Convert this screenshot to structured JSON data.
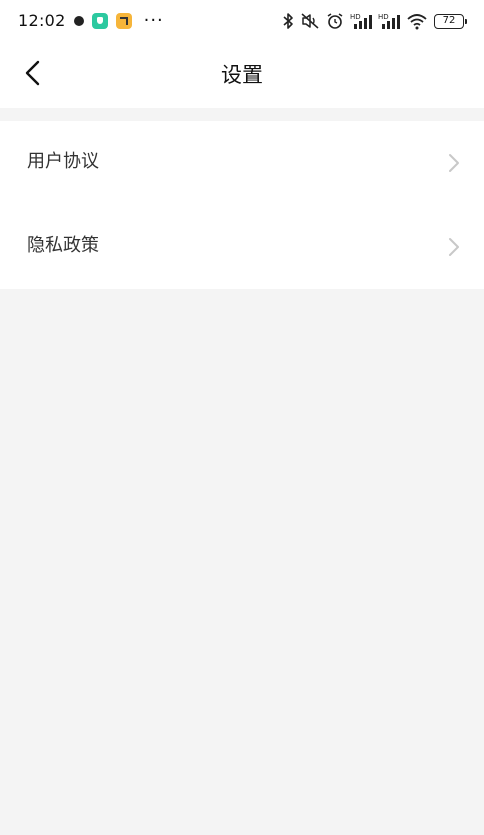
{
  "status_bar": {
    "time": "12:02",
    "more": "···",
    "battery_level": "72",
    "icons": [
      "dot-icon",
      "app-shield-icon",
      "app-mail-icon",
      "bluetooth-icon",
      "mute-icon",
      "alarm-icon",
      "signal-hd-icon",
      "signal-hd-icon",
      "wifi-icon",
      "battery-icon"
    ]
  },
  "header": {
    "title": "设置",
    "back_icon": "chevron-left-icon"
  },
  "settings": {
    "items": [
      {
        "label": "用户协议",
        "icon": "chevron-right-icon"
      },
      {
        "label": "隐私政策",
        "icon": "chevron-right-icon"
      }
    ]
  },
  "colors": {
    "background": "#f4f4f4",
    "surface": "#ffffff",
    "text_primary": "#111111",
    "text_secondary": "#333333",
    "chevron": "#c8c8c8"
  }
}
